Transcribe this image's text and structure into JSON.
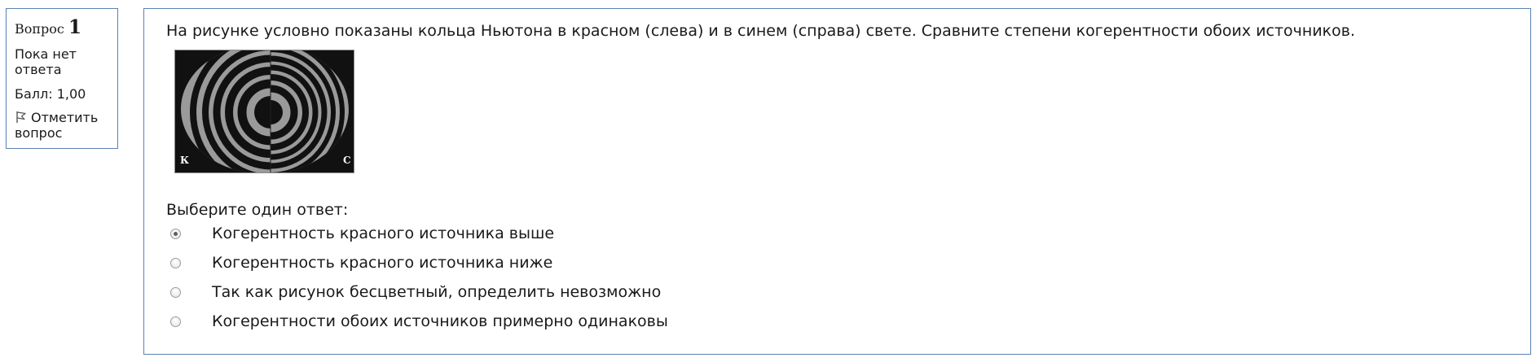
{
  "info": {
    "question_prefix": "Вопрос",
    "question_number": "1",
    "state": "Пока нет ответа",
    "grade": "Балл: 1,00",
    "flag_label": "Отметить вопрос"
  },
  "question": {
    "text": "На рисунке условно показаны кольца Ньютона в красном (слева) и в синем (справа) свете. Сравните степени когерентности обоих источников.",
    "figure": {
      "left_label": "К",
      "right_label": "С"
    },
    "prompt": "Выберите один ответ:",
    "answers": [
      {
        "label": "Когерентность красного источника выше",
        "selected": true
      },
      {
        "label": "Когерентность красного источника ниже",
        "selected": false
      },
      {
        "label": "Так как рисунок бесцветный, определить невозможно",
        "selected": false
      },
      {
        "label": "Когерентности обоих источников примерно одинаковы",
        "selected": false
      }
    ]
  }
}
